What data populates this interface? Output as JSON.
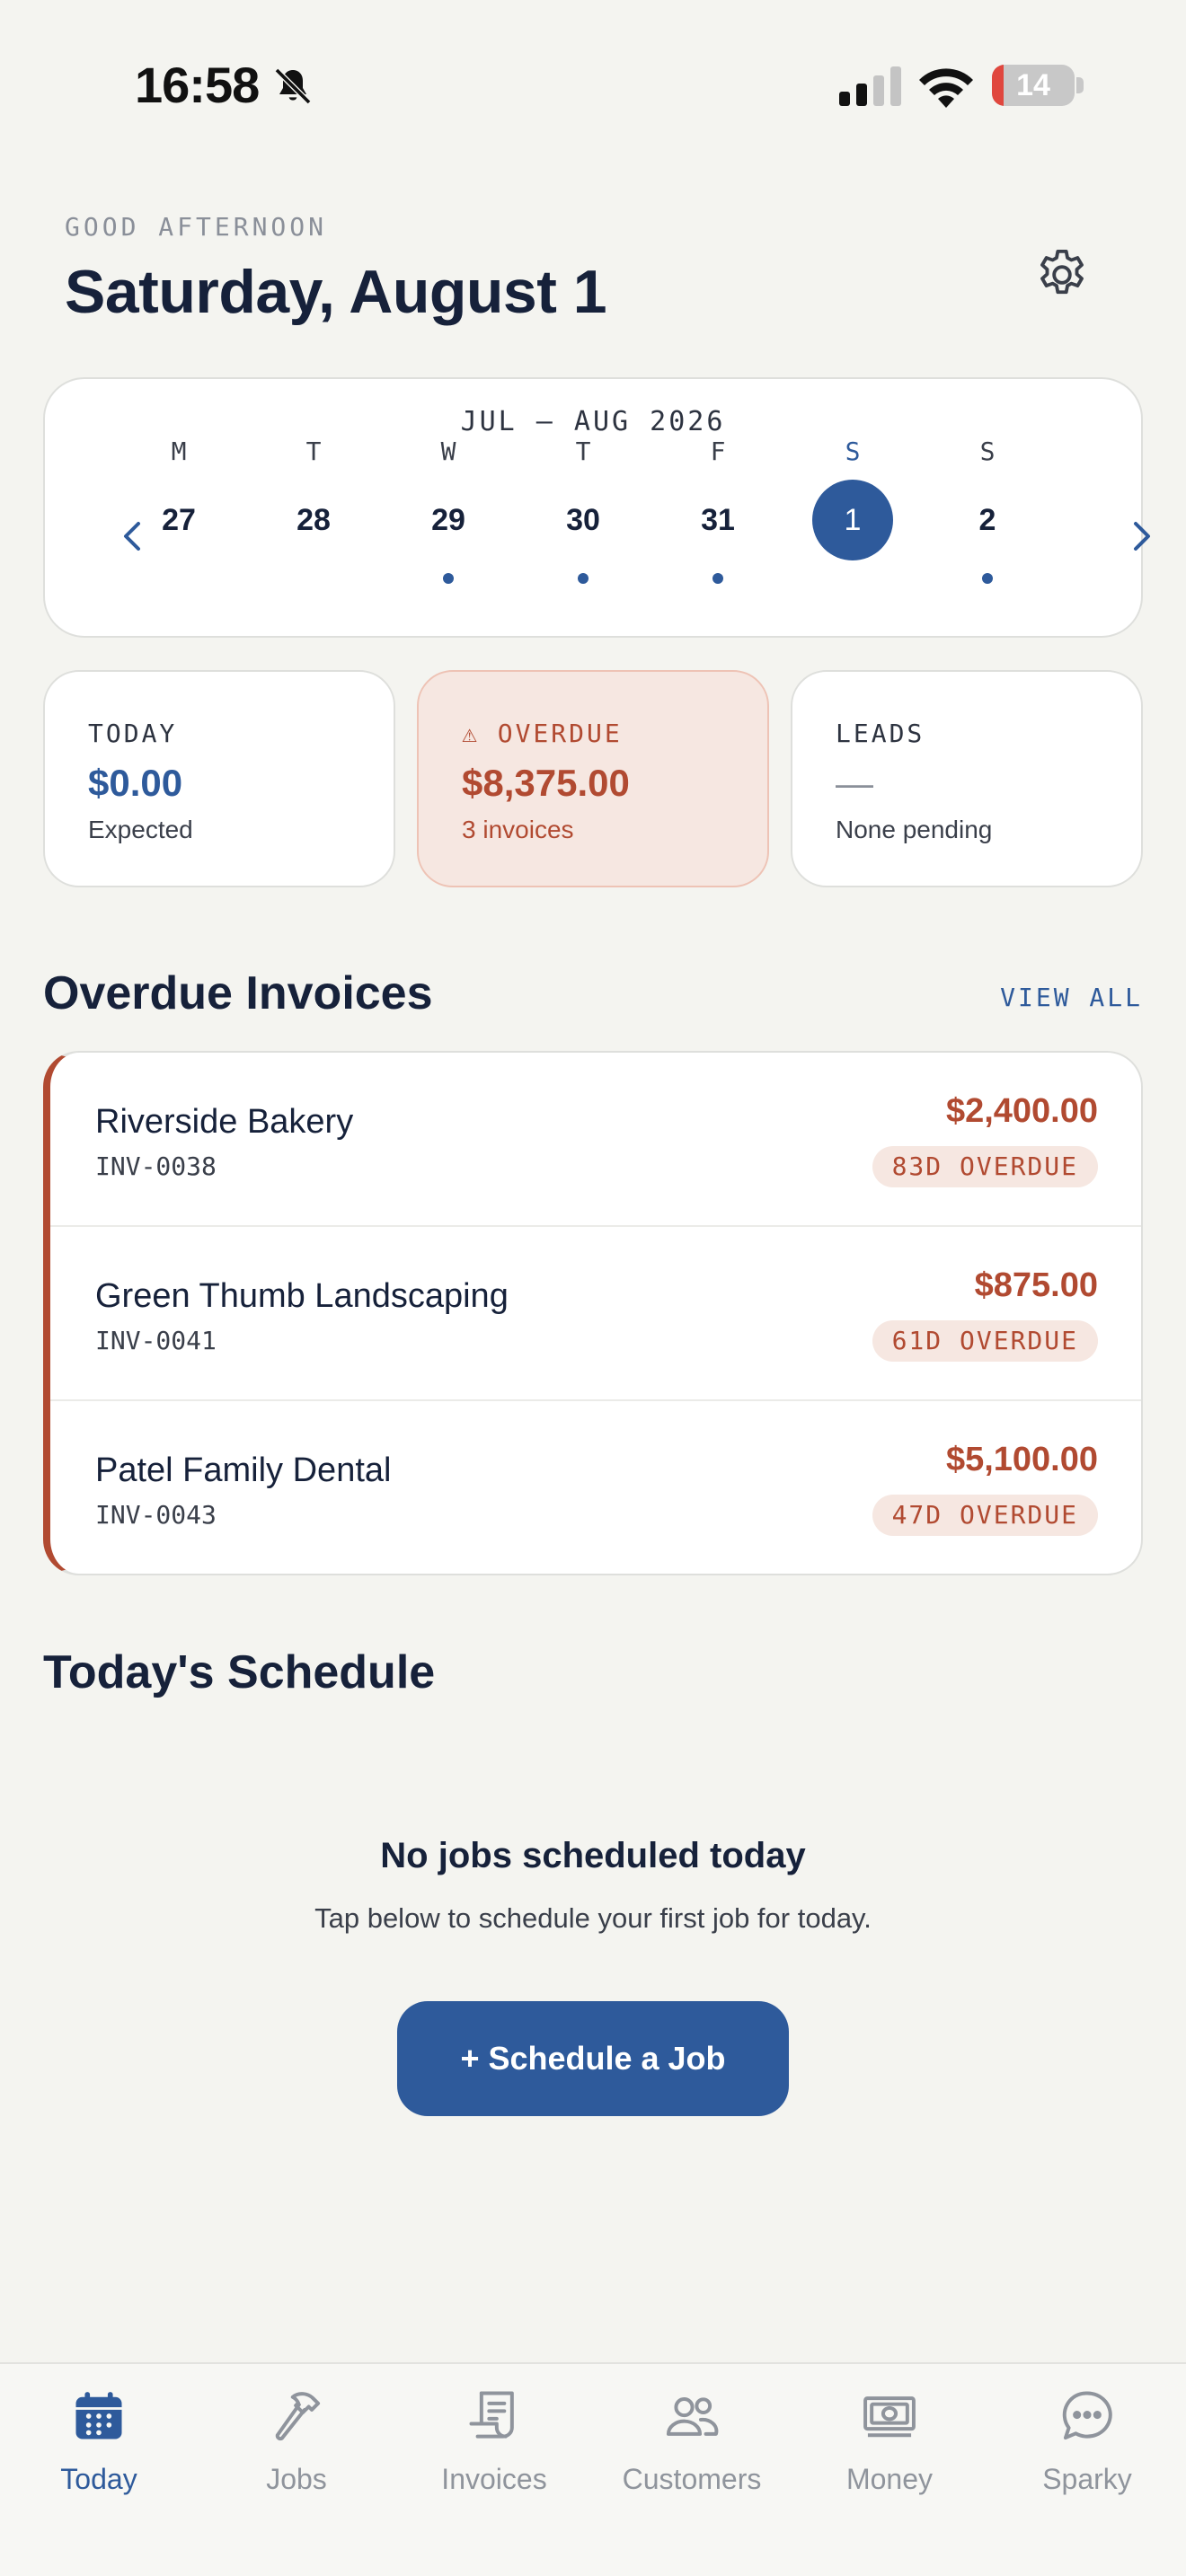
{
  "status_bar": {
    "time": "16:58",
    "battery_level": "14",
    "battery_fraction": 0.14
  },
  "header": {
    "greeting": "GOOD AFTERNOON",
    "title": "Saturday, August 1",
    "settings_icon": "gear-icon"
  },
  "calendar": {
    "range_label": "JUL – AUG 2026",
    "days": [
      {
        "dow": "M",
        "date": "27",
        "has_jobs": false,
        "selected": false
      },
      {
        "dow": "T",
        "date": "28",
        "has_jobs": false,
        "selected": false
      },
      {
        "dow": "W",
        "date": "29",
        "has_jobs": true,
        "selected": false
      },
      {
        "dow": "T",
        "date": "30",
        "has_jobs": true,
        "selected": false
      },
      {
        "dow": "F",
        "date": "31",
        "has_jobs": true,
        "selected": false
      },
      {
        "dow": "S",
        "date": "1",
        "has_jobs": false,
        "selected": true
      },
      {
        "dow": "S",
        "date": "2",
        "has_jobs": true,
        "selected": false
      }
    ]
  },
  "stats": {
    "today": {
      "label": "TODAY",
      "value": "$0.00",
      "sub": "Expected"
    },
    "overdue": {
      "label": "⚠ OVERDUE",
      "value": "$8,375.00",
      "sub": "3 invoices"
    },
    "leads": {
      "label": "LEADS",
      "value": "—",
      "sub": "None pending"
    }
  },
  "overdue_invoices": {
    "title": "Overdue Invoices",
    "view_all": "VIEW ALL",
    "items": [
      {
        "customer": "Riverside Bakery",
        "number": "INV-0038",
        "amount": "$2,400.00",
        "badge": "83D OVERDUE"
      },
      {
        "customer": "Green Thumb Landscaping",
        "number": "INV-0041",
        "amount": "$875.00",
        "badge": "61D OVERDUE"
      },
      {
        "customer": "Patel Family Dental",
        "number": "INV-0043",
        "amount": "$5,100.00",
        "badge": "47D OVERDUE"
      }
    ]
  },
  "schedule": {
    "title": "Today's Schedule",
    "empty_title": "No jobs scheduled today",
    "empty_sub": "Tap below to schedule your first job for today.",
    "button": "+ Schedule a Job"
  },
  "tabs": [
    {
      "label": "Today",
      "icon": "calendar-icon",
      "active": true
    },
    {
      "label": "Jobs",
      "icon": "hammer-icon",
      "active": false
    },
    {
      "label": "Invoices",
      "icon": "receipt-icon",
      "active": false
    },
    {
      "label": "Customers",
      "icon": "people-icon",
      "active": false
    },
    {
      "label": "Money",
      "icon": "banknote-icon",
      "active": false
    },
    {
      "label": "Sparky",
      "icon": "chat-bubble-icon",
      "active": false
    }
  ],
  "colors": {
    "accent": "#2e5a9b",
    "danger": "#b14a31",
    "background": "#f4f4f0"
  }
}
